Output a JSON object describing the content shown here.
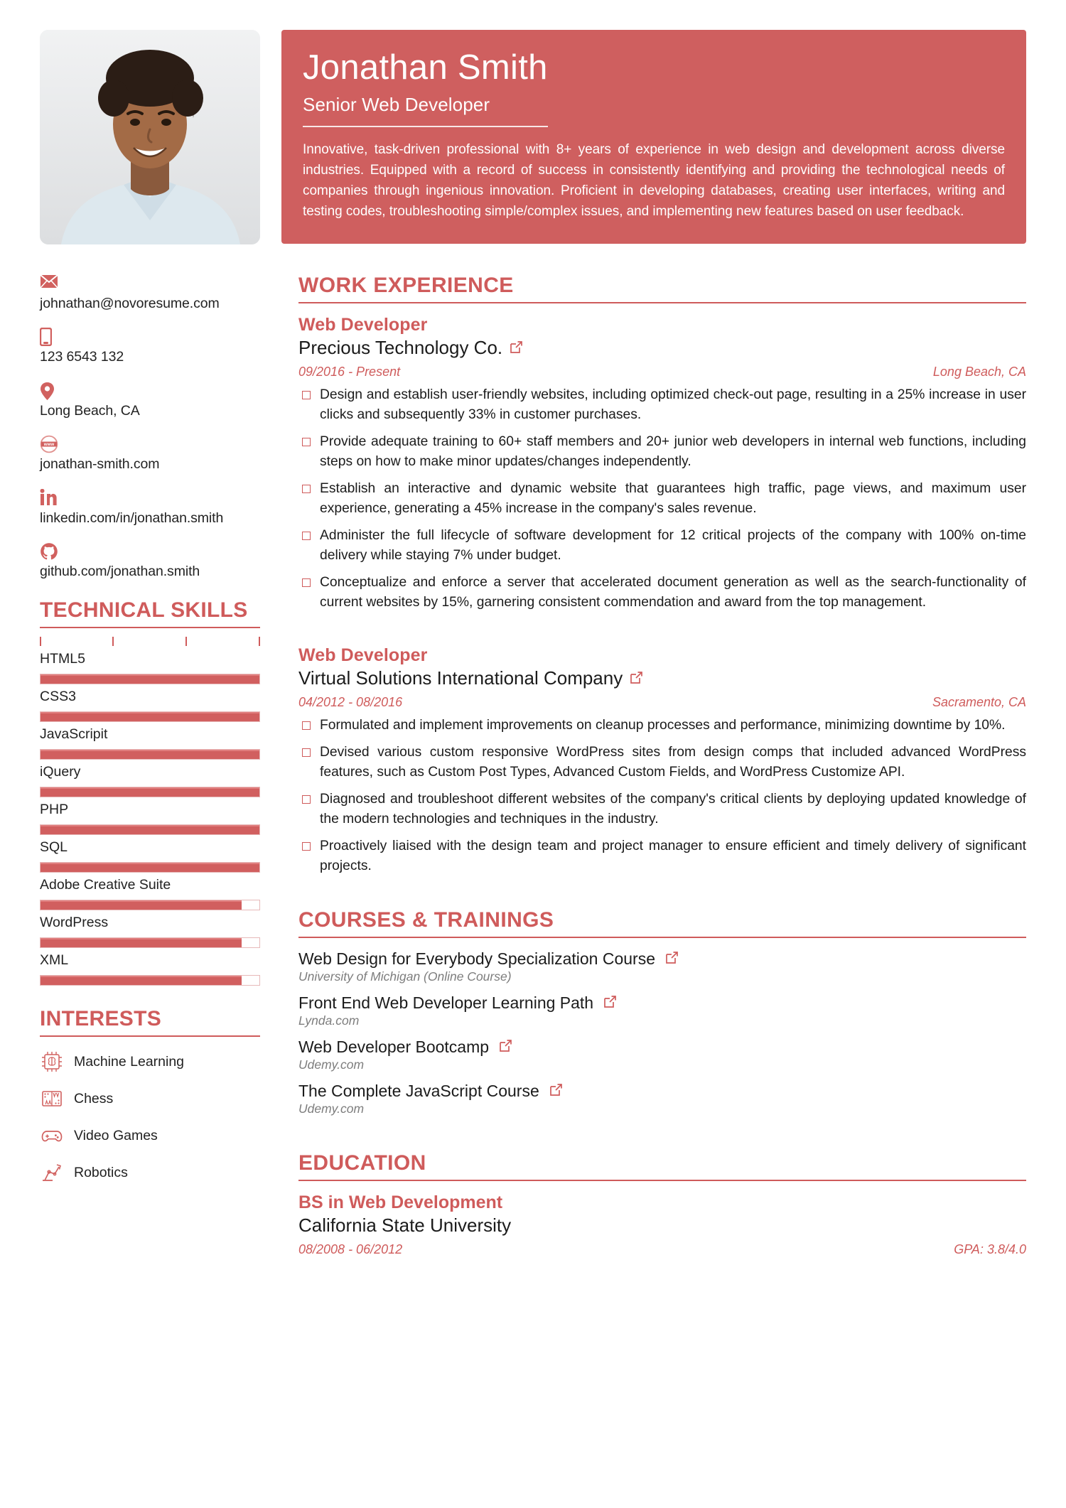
{
  "colors": {
    "accent": "#cf5b5b",
    "banner": "#cf5f5f",
    "text": "#1b1b1b",
    "muted": "#7d7d7d"
  },
  "header": {
    "name": "Jonathan Smith",
    "title": "Senior Web Developer",
    "summary": "Innovative, task-driven professional with 8+ years of experience in web design and development across diverse industries. Equipped with a record of success in consistently identifying and providing the technological needs of companies through ingenious innovation. Proficient in developing databases, creating user interfaces, writing and testing codes, troubleshooting simple/complex issues, and implementing new features based on user feedback."
  },
  "contact": [
    {
      "icon": "email-icon",
      "value": "johnathan@novoresume.com"
    },
    {
      "icon": "phone-icon",
      "value": "123 6543 132"
    },
    {
      "icon": "location-pin-icon",
      "value": "Long Beach, CA"
    },
    {
      "icon": "website-www-icon",
      "value": "jonathan-smith.com"
    },
    {
      "icon": "linkedin-icon",
      "value": "linkedin.com/in/jonathan.smith"
    },
    {
      "icon": "github-icon",
      "value": "github.com/jonathan.smith"
    }
  ],
  "skills_section": {
    "heading": "TECHNICAL SKILLS",
    "items": [
      {
        "label": "HTML5",
        "level": 100
      },
      {
        "label": "CSS3",
        "level": 100
      },
      {
        "label": "JavaScripit",
        "level": 100
      },
      {
        "label": "iQuery",
        "level": 100
      },
      {
        "label": "PHP",
        "level": 100
      },
      {
        "label": "SQL",
        "level": 100
      },
      {
        "label": "Adobe Creative Suite",
        "level": 92
      },
      {
        "label": "WordPress",
        "level": 92
      },
      {
        "label": "XML",
        "level": 92
      }
    ]
  },
  "interests_section": {
    "heading": "INTERESTS",
    "items": [
      {
        "icon": "machine-learning-chip-icon",
        "label": "Machine Learning"
      },
      {
        "icon": "chess-board-icon",
        "label": "Chess"
      },
      {
        "icon": "gamepad-icon",
        "label": "Video Games"
      },
      {
        "icon": "robot-arm-icon",
        "label": "Robotics"
      }
    ]
  },
  "work_section": {
    "heading": "WORK EXPERIENCE",
    "jobs": [
      {
        "title": "Web Developer",
        "company": "Precious Technology Co.",
        "link_icon": "external-link-icon",
        "dates": "09/2016 - Present",
        "location": "Long Beach, CA",
        "bullets": [
          "Design and establish user-friendly websites, including optimized check-out page, resulting in a 25% increase in user clicks and subsequently 33% in customer purchases.",
          "Provide adequate training to 60+ staff members and 20+ junior web developers in internal web functions, including steps on how to make minor updates/changes independently.",
          "Establish an interactive and dynamic website that guarantees high traffic, page views, and maximum user experience, generating a 45% increase in the company's sales revenue.",
          "Administer the full lifecycle of software development for 12 critical projects of the company with 100% on-time delivery while staying 7% under budget.",
          "Conceptualize and enforce a server that accelerated document generation as well as the search-functionality of current websites by 15%, garnering consistent commendation and award from the top management."
        ]
      },
      {
        "title": "Web Developer",
        "company": "Virtual Solutions International Company",
        "link_icon": "external-link-icon",
        "dates": "04/2012 - 08/2016",
        "location": "Sacramento, CA",
        "bullets": [
          "Formulated and implement improvements on cleanup processes and performance, minimizing downtime by 10%.",
          "Devised various custom responsive WordPress sites from design comps that included advanced WordPress features, such as Custom Post Types, Advanced Custom Fields, and WordPress Customize API.",
          "Diagnosed and troubleshoot different websites of the company's critical clients by deploying updated knowledge of the modern technologies and techniques in the industry.",
          "Proactively liaised with the design team and project manager to ensure efficient and timely delivery of significant projects."
        ]
      }
    ]
  },
  "courses_section": {
    "heading": "COURSES & TRAININGS",
    "items": [
      {
        "title": "Web Design for Everybody Specialization Course",
        "link_icon": "external-link-icon",
        "source": "University of Michigan (Online Course)"
      },
      {
        "title": "Front End Web Developer Learning Path",
        "link_icon": "external-link-icon",
        "source": "Lynda.com"
      },
      {
        "title": "Web Developer Bootcamp",
        "link_icon": "external-link-icon",
        "source": "Udemy.com"
      },
      {
        "title": "The Complete JavaScript Course",
        "link_icon": "external-link-icon",
        "source": "Udemy.com"
      }
    ]
  },
  "education_section": {
    "heading": "EDUCATION",
    "degree": "BS in Web Development",
    "school": "California State University",
    "dates": "08/2008 - 06/2012",
    "gpa": "GPA: 3.8/4.0"
  }
}
